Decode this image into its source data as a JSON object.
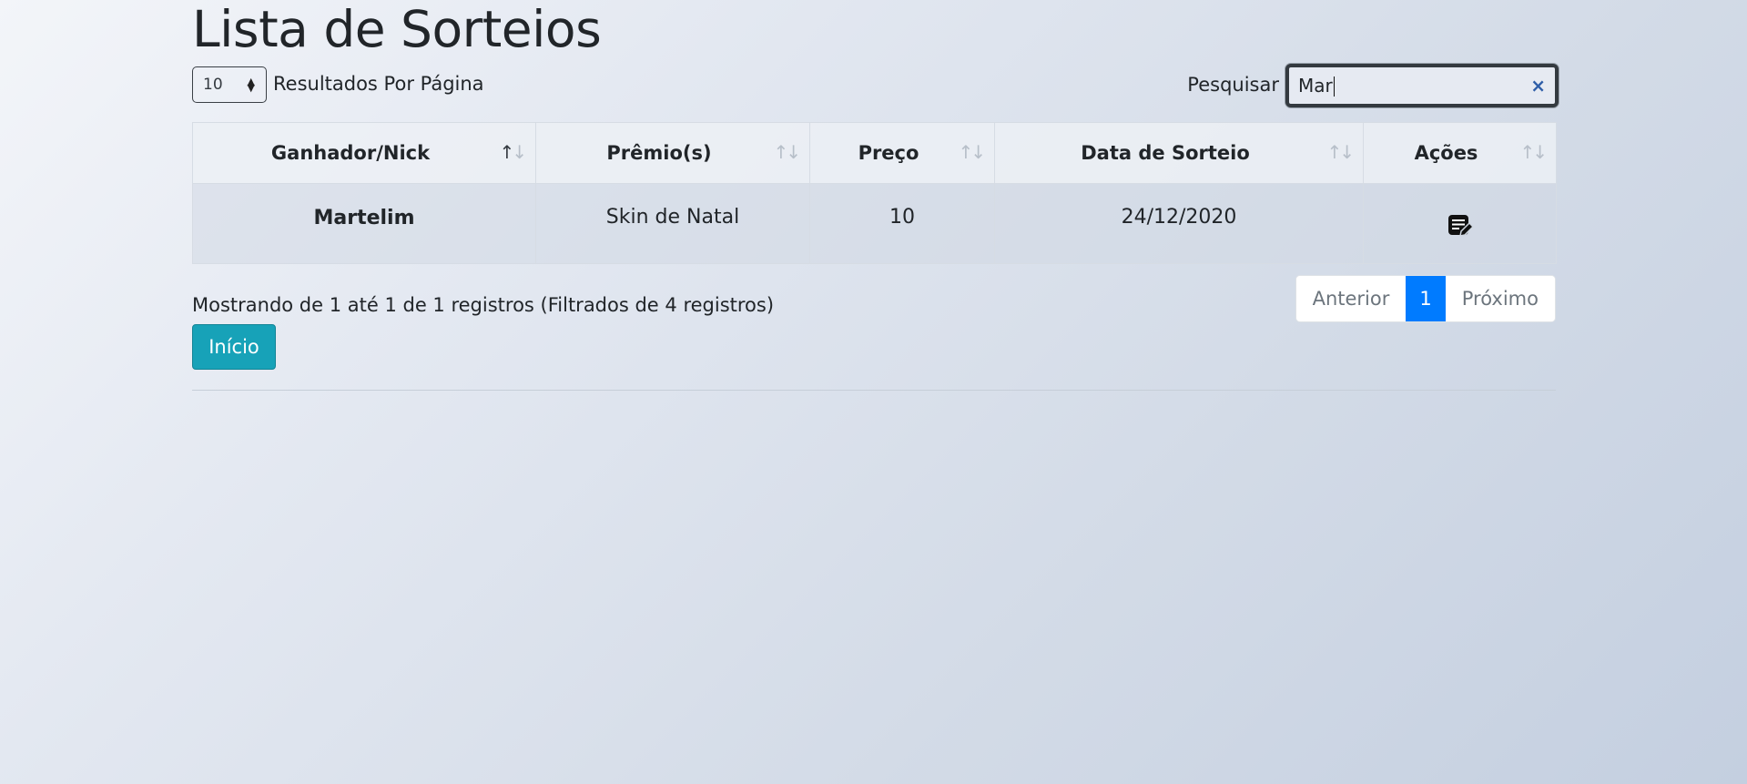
{
  "page": {
    "title": "Lista de Sorteios"
  },
  "length_control": {
    "value": "10",
    "label": "Resultados Por Página"
  },
  "search": {
    "label": "Pesquisar",
    "value": "Mar",
    "clear_glyph": "×"
  },
  "table": {
    "columns": [
      {
        "label": "Ganhador/Nick",
        "sort": "active"
      },
      {
        "label": "Prêmio(s)",
        "sort": "none"
      },
      {
        "label": "Preço",
        "sort": "none"
      },
      {
        "label": "Data de Sorteio",
        "sort": "none"
      },
      {
        "label": "Ações",
        "sort": "none"
      }
    ],
    "rows": [
      {
        "nick": "Martelim",
        "premio": "Skin de Natal",
        "preco": "10",
        "data": "24/12/2020",
        "action_icon": "edit-note-icon"
      }
    ]
  },
  "info": "Mostrando de 1 até 1 de 1 registros (Filtrados de 4 registros)",
  "pagination": {
    "prev": "Anterior",
    "current": "1",
    "next": "Próximo"
  },
  "home_button": "Início",
  "colors": {
    "primary": "#007bff",
    "info_button": "#17a2b8",
    "search_clear": "#2f5ea8"
  }
}
